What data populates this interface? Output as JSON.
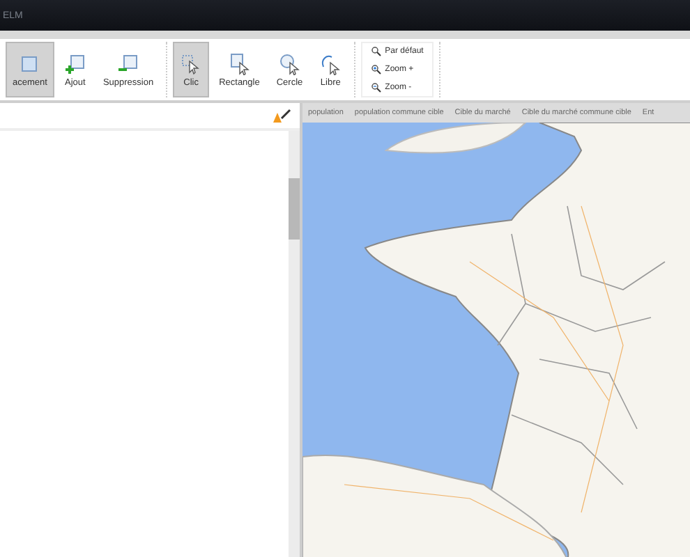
{
  "window": {
    "title": "ELM"
  },
  "toolbar": {
    "groups": [
      {
        "kind": "large",
        "buttons": [
          {
            "label": "acement",
            "selected": true,
            "kind": "move"
          },
          {
            "label": "Ajout",
            "selected": false,
            "kind": "add"
          },
          {
            "label": "Suppression",
            "selected": false,
            "kind": "remove"
          }
        ]
      },
      {
        "kind": "large",
        "buttons": [
          {
            "label": "Clic",
            "selected": true,
            "kind": "click"
          },
          {
            "label": "Rectangle",
            "selected": false,
            "kind": "rect"
          },
          {
            "label": "Cercle",
            "selected": false,
            "kind": "circle"
          },
          {
            "label": "Libre",
            "selected": false,
            "kind": "free"
          }
        ]
      },
      {
        "kind": "small",
        "buttons": [
          {
            "label": "Par défaut",
            "selected": false,
            "kind": "zoom"
          },
          {
            "label": "Zoom +",
            "selected": false,
            "kind": "zoomin"
          },
          {
            "label": "Zoom -",
            "selected": false,
            "kind": "zoomout"
          }
        ]
      }
    ]
  },
  "map_tabs": [
    {
      "label": "population",
      "selected": false
    },
    {
      "label": "population commune cible",
      "selected": false
    },
    {
      "label": "Cible du marché",
      "selected": false
    },
    {
      "label": "Cible du marché commune cible",
      "selected": false
    },
    {
      "label": "Ent",
      "selected": false
    }
  ]
}
